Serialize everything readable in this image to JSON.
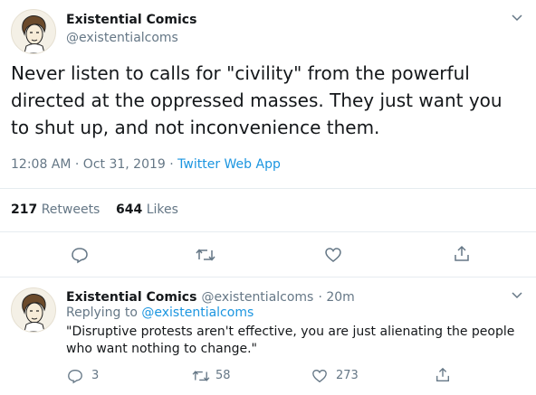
{
  "main_tweet": {
    "author_name": "Existential Comics",
    "author_handle": "@existentialcoms",
    "text": "Never listen to calls for \"civility\" from the powerful directed at the oppressed masses. They just want you to shut up, and not inconvenience them.",
    "timestamp": "12:08 AM · Oct 31, 2019 ·",
    "source": "Twitter Web App",
    "retweets_count": "217",
    "retweets_label": "Retweets",
    "likes_count": "644",
    "likes_label": "Likes"
  },
  "reply": {
    "author_name": "Existential Comics",
    "author_handle": "@existentialcoms",
    "time_ago": "· 20m",
    "replying_prefix": "Replying to",
    "replying_handle": "@existentialcoms",
    "text": "\"Disruptive protests aren't effective, you are just alienating the people who want nothing to change.\"",
    "reply_count": "3",
    "retweet_count": "58",
    "like_count": "273"
  },
  "icons": [
    "chevron-down-icon",
    "reply-icon",
    "retweet-icon",
    "like-icon",
    "share-icon"
  ],
  "colors": {
    "link": "#1b95e0",
    "secondary_text": "#657786",
    "divider": "#e6ecf0"
  }
}
